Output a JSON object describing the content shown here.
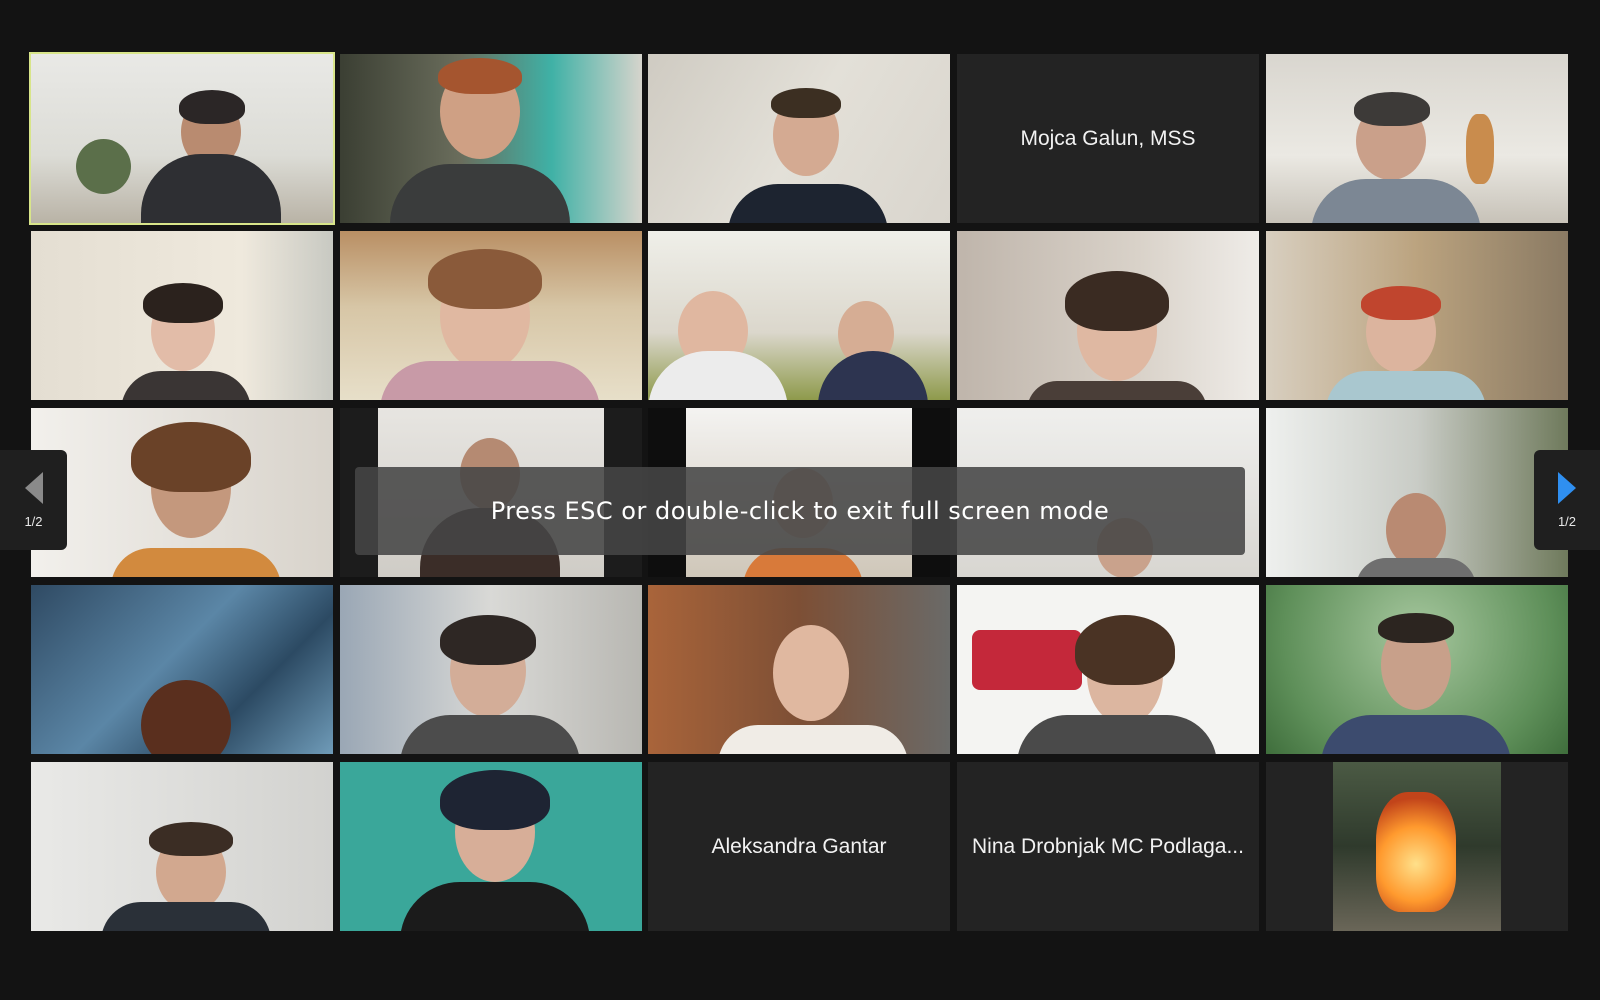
{
  "gallery": {
    "participants": [
      {
        "name": "",
        "video": true
      },
      {
        "name": "",
        "video": true
      },
      {
        "name": "",
        "video": true
      },
      {
        "name": "Mojca Galun, MSS",
        "video": false
      },
      {
        "name": "",
        "video": true
      },
      {
        "name": "",
        "video": true
      },
      {
        "name": "",
        "video": true
      },
      {
        "name": "",
        "video": true
      },
      {
        "name": "",
        "video": true
      },
      {
        "name": "",
        "video": true
      },
      {
        "name": "",
        "video": true
      },
      {
        "name": "",
        "video": true
      },
      {
        "name": "",
        "video": true
      },
      {
        "name": "",
        "video": true
      },
      {
        "name": "",
        "video": true
      },
      {
        "name": "",
        "video": true
      },
      {
        "name": "",
        "video": true
      },
      {
        "name": "",
        "video": true
      },
      {
        "name": "",
        "video": true
      },
      {
        "name": "",
        "video": true
      },
      {
        "name": "",
        "video": true
      },
      {
        "name": "",
        "video": true
      },
      {
        "name": "Aleksandra Gantar",
        "video": false
      },
      {
        "name": "Nina Drobnjak MC Podlaga...",
        "video": false
      },
      {
        "name": "",
        "video": true
      }
    ]
  },
  "nav": {
    "prev_page": "1/2",
    "next_page": "1/2"
  },
  "overlay": {
    "message": "Press ESC or double-click to exit full screen mode"
  },
  "colors": {
    "active_speaker_border": "#d8e58a",
    "next_arrow": "#2f8ff0",
    "background": "#131313"
  }
}
